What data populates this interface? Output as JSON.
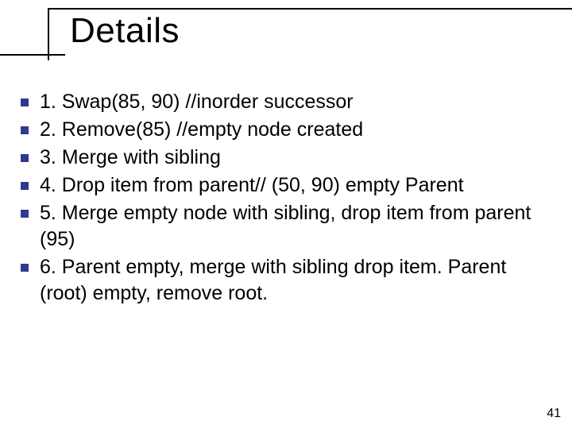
{
  "slide": {
    "title": "Details",
    "page_number": "41",
    "bullets": [
      "1.  Swap(85, 90)   //inorder successor",
      "2. Remove(85) //empty node created",
      "3. Merge with sibling",
      "4. Drop item from parent// (50, 90) empty Parent",
      "5. Merge empty node with sibling, drop item from parent (95)",
      "6. Parent empty, merge with sibling drop item. Parent (root) empty, remove root."
    ]
  }
}
